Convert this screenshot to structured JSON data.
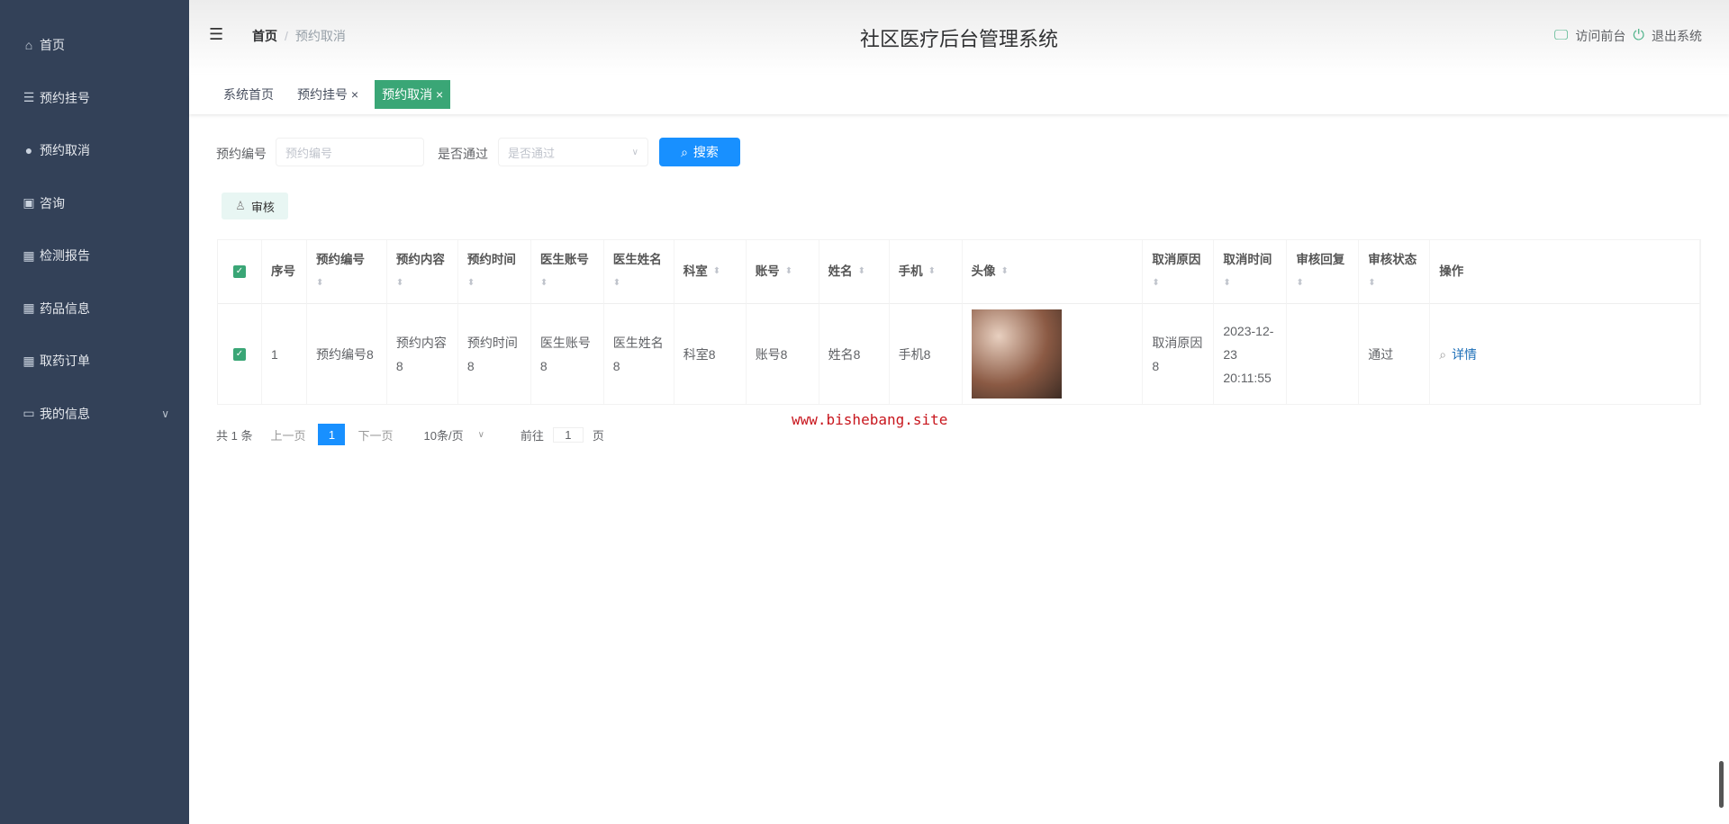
{
  "sidebar": {
    "items": [
      {
        "label": "首页",
        "icon": "home-icon",
        "glyph": "⌂"
      },
      {
        "label": "预约挂号",
        "icon": "list-icon",
        "glyph": "☰"
      },
      {
        "label": "预约取消",
        "icon": "bulb-icon",
        "glyph": "●"
      },
      {
        "label": "咨询",
        "icon": "clipboard-icon",
        "glyph": "▣"
      },
      {
        "label": "检测报告",
        "icon": "grid-icon",
        "glyph": "▦"
      },
      {
        "label": "药品信息",
        "icon": "grid-icon",
        "glyph": "▦"
      },
      {
        "label": "取药订单",
        "icon": "table-icon",
        "glyph": "▦"
      },
      {
        "label": "我的信息",
        "icon": "card-icon",
        "glyph": "▭"
      }
    ]
  },
  "header": {
    "title": "社区医疗后台管理系统",
    "breadcrumb": [
      "首页",
      "预约取消"
    ],
    "visit_front": "访问前台",
    "logout": "退出系统"
  },
  "tabs": [
    {
      "label": "系统首页"
    },
    {
      "label": "预约挂号 ×"
    },
    {
      "label": "预约取消 ×"
    }
  ],
  "search": {
    "field1_label": "预约编号",
    "field1_placeholder": "预约编号",
    "field2_label": "是否通过",
    "field2_placeholder": "是否通过",
    "button": "搜索"
  },
  "toolbar": {
    "audit": "审核"
  },
  "table": {
    "columns": [
      "序号",
      "预约编号",
      "预约内容",
      "预约时间",
      "医生账号",
      "医生姓名",
      "科室",
      "账号",
      "姓名",
      "手机",
      "头像",
      "取消原因",
      "取消时间",
      "审核回复",
      "审核状态",
      "操作"
    ],
    "rows": [
      [
        "1",
        "预约编号8",
        "预约内容8",
        "预约时间8",
        "医生账号8",
        "医生姓名8",
        "科室8",
        "账号8",
        "姓名8",
        "手机8",
        "",
        "取消原因8",
        "2023-12-23 20:11:55",
        "",
        "通过",
        ""
      ]
    ],
    "detail": "详情"
  },
  "pagination": {
    "total": "共 1 条",
    "prev": "上一页",
    "page": "1",
    "next": "下一页",
    "size": "10条/页",
    "goto": "前往",
    "goto_value": "1",
    "page_unit": "页"
  },
  "watermark": "www.bishebang.site"
}
